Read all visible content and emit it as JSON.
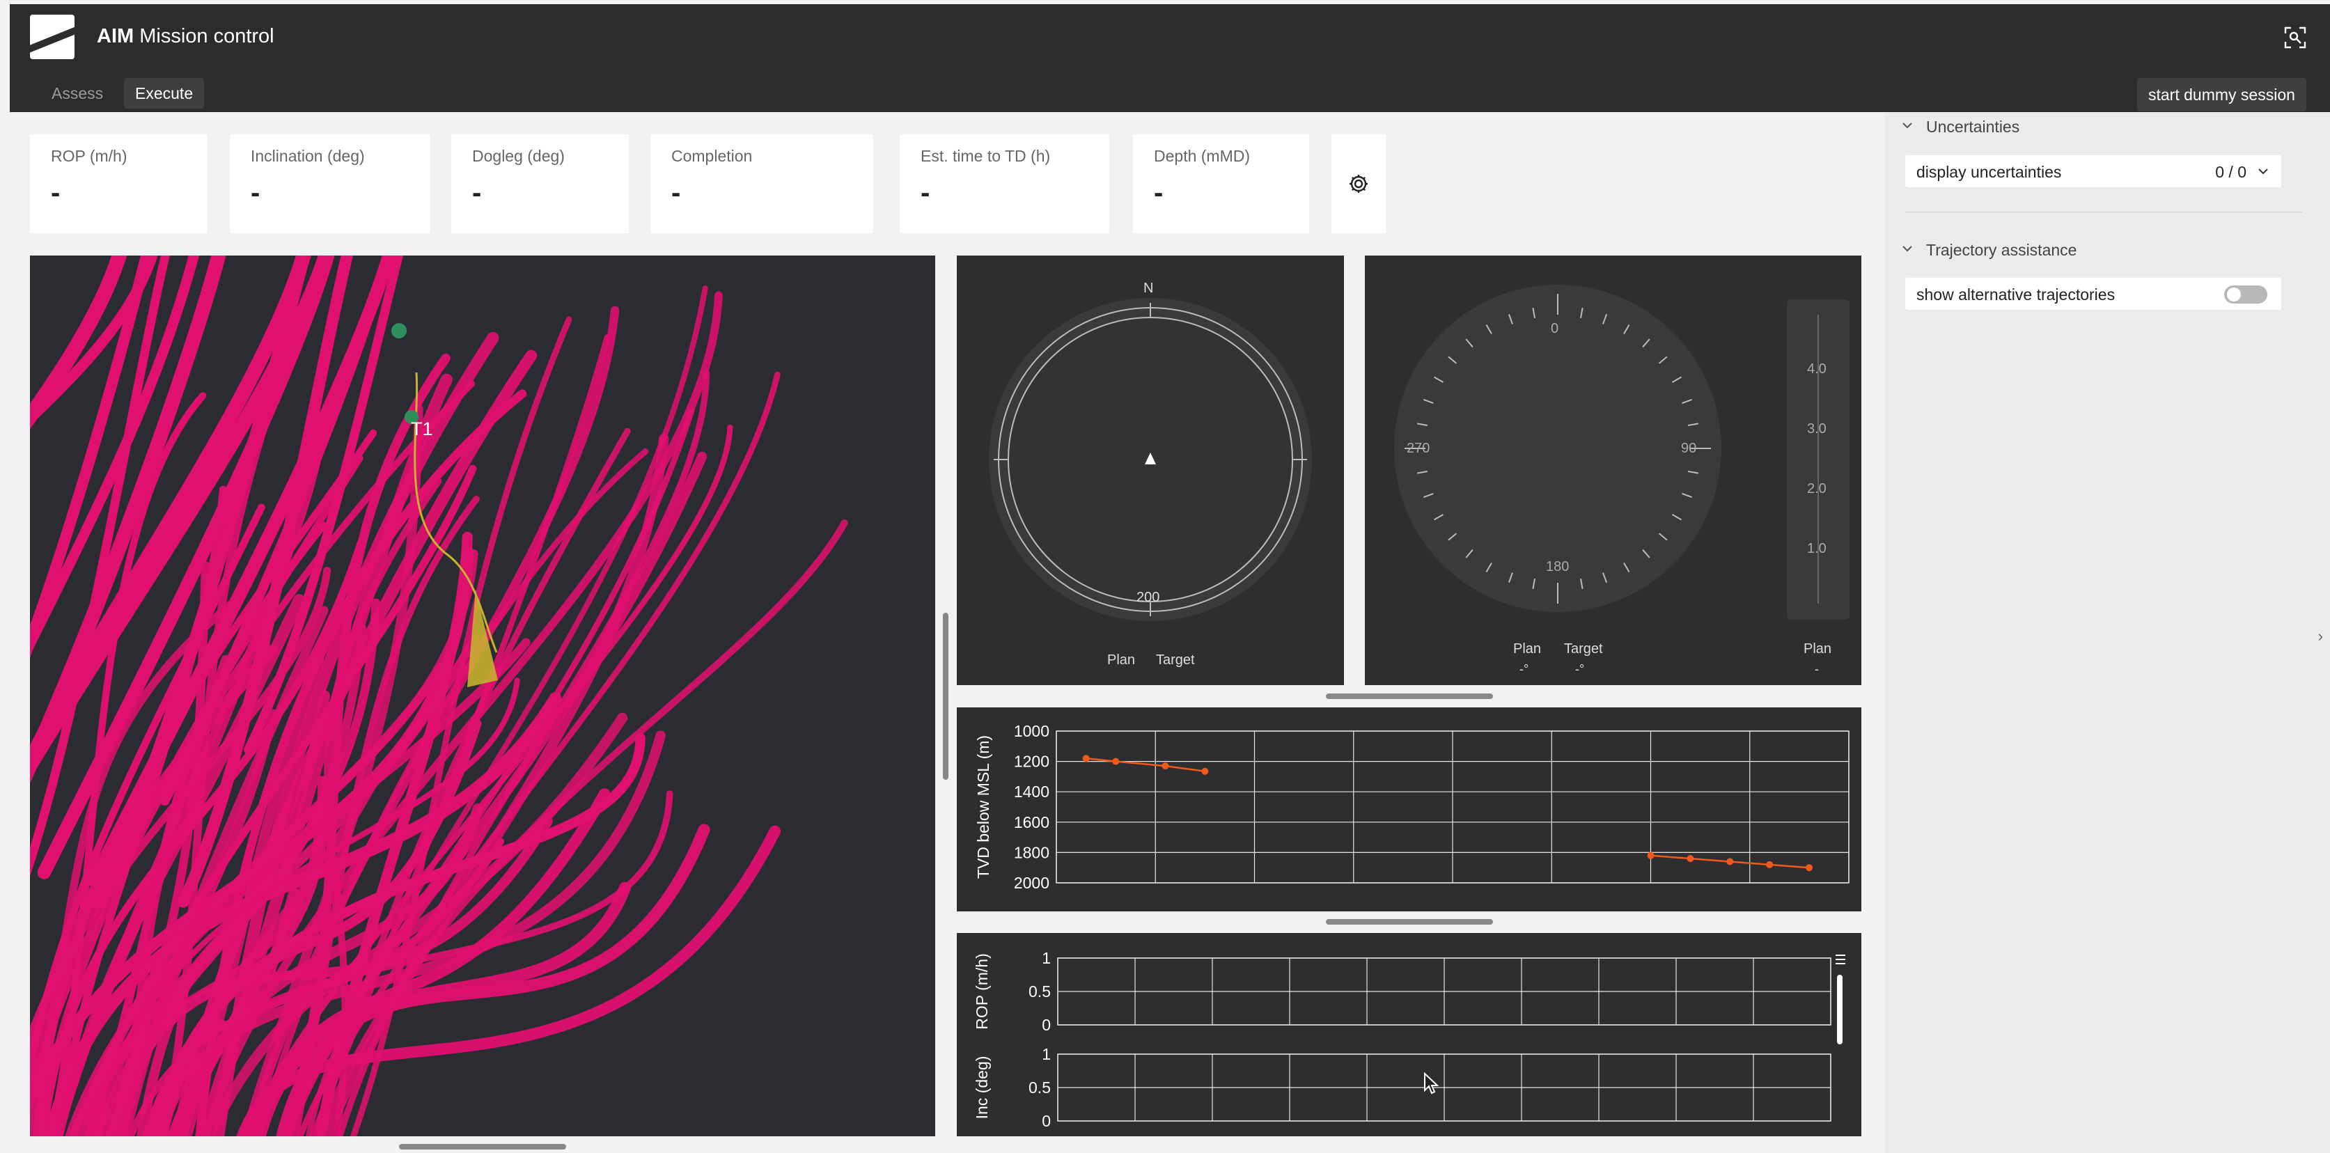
{
  "app": {
    "title_bold": "AIM",
    "title_rest": " Mission control"
  },
  "tabs": [
    {
      "label": "Assess"
    },
    {
      "label": "Execute"
    }
  ],
  "actions": {
    "start_session_label": "start dummy session"
  },
  "kpis": [
    {
      "label": "ROP (m/h)",
      "value": "-"
    },
    {
      "label": "Inclination (deg)",
      "value": "-"
    },
    {
      "label": "Dogleg (deg)",
      "value": "-"
    },
    {
      "label": "Completion",
      "value": "-"
    },
    {
      "label": "Est. time to TD (h)",
      "value": "-"
    },
    {
      "label": "Depth (mMD)",
      "value": "-"
    }
  ],
  "view3d": {
    "target_label": "T1"
  },
  "compass": {
    "north_label": "N",
    "bottom_label": "200",
    "legend_plan": "Plan",
    "legend_target": "Target"
  },
  "azimuth_dial": {
    "tick_labels": {
      "top": "0",
      "right": "90",
      "bottom": "180",
      "left": "270"
    },
    "legend_plan": "Plan",
    "legend_target": "Target",
    "plan_value": "-°",
    "target_value": "-°",
    "scale_labels": [
      "4.0",
      "3.0",
      "2.0",
      "1.0"
    ],
    "scale_legend": "Plan",
    "scale_value": "-"
  },
  "chart_data": [
    {
      "type": "line",
      "title": "",
      "ylabel": "TVD below MSL (m)",
      "xlabel": "",
      "ylim": [
        2000,
        1000
      ],
      "y_ticks": [
        "1000",
        "1200",
        "1400",
        "1600",
        "1800",
        "2000"
      ],
      "series": [
        {
          "name": "",
          "color": "#f05a1a",
          "points": [
            [
              0.3,
              1180
            ],
            [
              0.6,
              1200
            ],
            [
              1.1,
              1230
            ],
            [
              1.5,
              1265
            ]
          ]
        },
        {
          "name": "",
          "color": "#f05a1a",
          "points": [
            [
              6.0,
              1820
            ],
            [
              6.4,
              1840
            ],
            [
              6.8,
              1860
            ],
            [
              7.2,
              1880
            ],
            [
              7.6,
              1900
            ]
          ]
        }
      ],
      "x_range": [
        0,
        8
      ],
      "grid": true
    },
    {
      "type": "line",
      "ylabel": "ROP (m/h)",
      "y_ticks": [
        "1",
        "0.5",
        "0"
      ],
      "ylim": [
        0,
        1
      ],
      "series": [],
      "grid": true
    },
    {
      "type": "line",
      "ylabel": "Inc (deg)",
      "y_ticks": [
        "1",
        "0.5",
        "0"
      ],
      "ylim": [
        0,
        1
      ],
      "series": [],
      "grid": true
    }
  ],
  "sidebar": {
    "uncertainties": {
      "title": "Uncertainties",
      "dropdown_label": "display uncertainties",
      "dropdown_value": "0 / 0"
    },
    "trajectory": {
      "title": "Trajectory assistance",
      "toggle_label": "show alternative trajectories",
      "toggle_on": false
    }
  },
  "colors": {
    "accent": "#e0106f",
    "series": "#f05a1a",
    "panel": "#2e2e30"
  }
}
